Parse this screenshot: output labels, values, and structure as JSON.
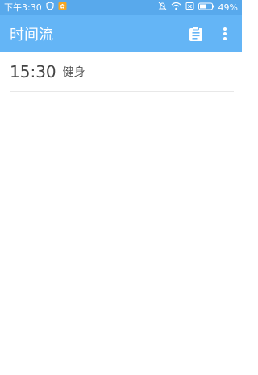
{
  "status_bar": {
    "time": "下午3:30",
    "battery": "49%",
    "icons": [
      "shield-icon",
      "notification-app-icon",
      "mute-icon",
      "wifi-icon",
      "sim-off-icon",
      "battery-icon"
    ]
  },
  "app_bar": {
    "title": "时间流",
    "actions": [
      "clipboard-icon",
      "more-vert-icon"
    ]
  },
  "entries": [
    {
      "time": "15:30",
      "label": "健身"
    }
  ],
  "colors": {
    "status_bar": "#58a9ec",
    "app_bar": "#64b5f6"
  }
}
